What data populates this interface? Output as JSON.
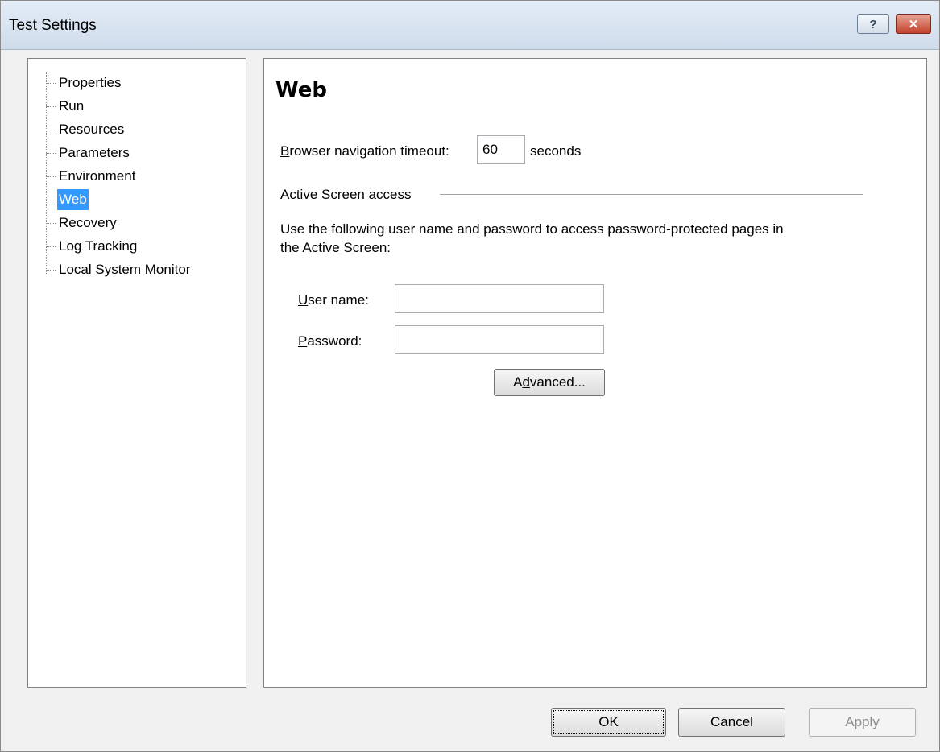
{
  "window": {
    "title": "Test Settings",
    "help_glyph": "?",
    "close_glyph": "✕"
  },
  "tree": {
    "items": [
      {
        "label": "Properties"
      },
      {
        "label": "Run"
      },
      {
        "label": "Resources"
      },
      {
        "label": "Parameters"
      },
      {
        "label": "Environment"
      },
      {
        "label": "Web",
        "selected": true
      },
      {
        "label": "Recovery"
      },
      {
        "label": "Log Tracking"
      },
      {
        "label": "Local System Monitor"
      }
    ]
  },
  "content": {
    "title": "Web",
    "timeout": {
      "label_first": "B",
      "label_rest": "rowser navigation timeout:",
      "value": "60",
      "unit": "seconds"
    },
    "active_screen": {
      "group_label": "Active Screen access",
      "description_line1": "Use the following user name and password to access password-protected pages in",
      "description_line2": "the Active Screen:",
      "username_label_first": "U",
      "username_label_rest": "ser name:",
      "username_value": "",
      "password_label_first": "P",
      "password_label_rest": "assword:",
      "password_value": "",
      "advanced_before": "A",
      "advanced_accel": "d",
      "advanced_after": "vanced..."
    }
  },
  "footer": {
    "ok_label": "OK",
    "cancel_label": "Cancel",
    "apply_label": "Apply"
  },
  "colors": {
    "selection": "#3399ff",
    "dialog_background": "#f0f0f0"
  }
}
